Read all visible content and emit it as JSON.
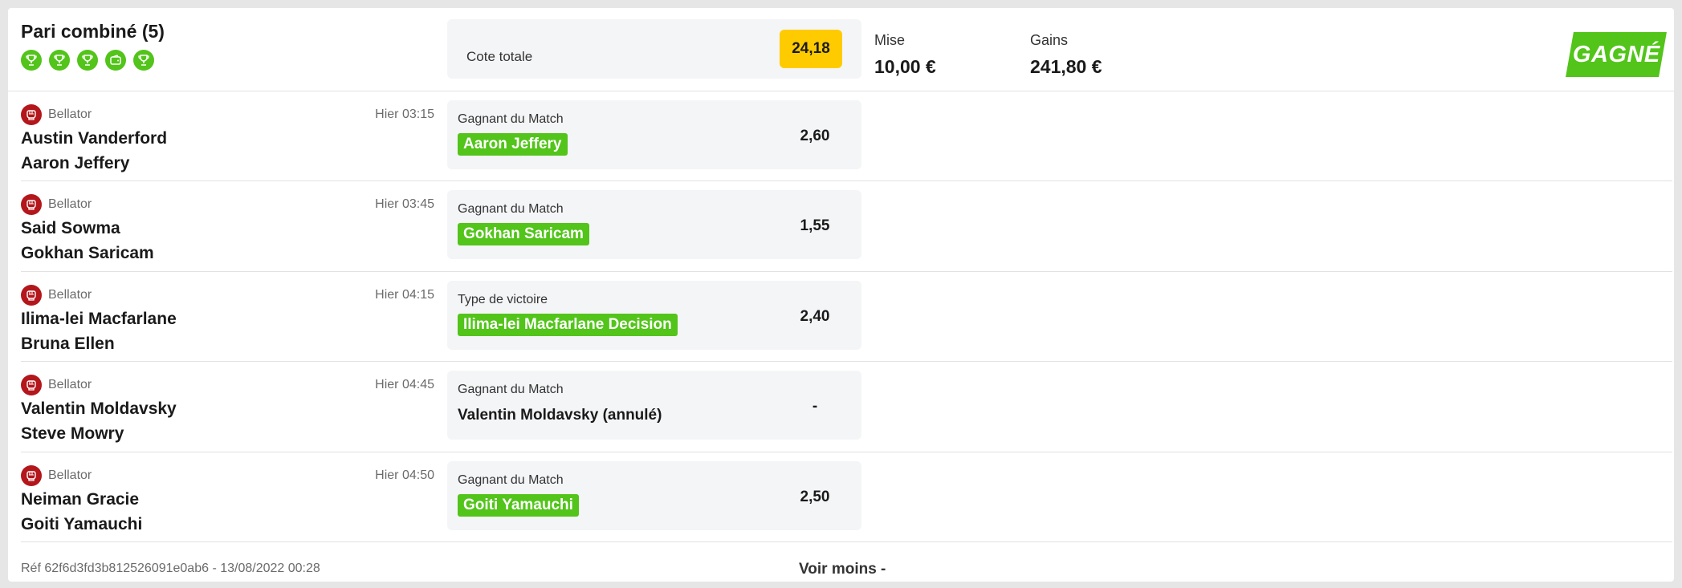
{
  "header": {
    "title": "Pari combiné (5)",
    "result_icons": [
      "trophy-icon",
      "trophy-icon",
      "trophy-icon",
      "refund-icon",
      "trophy-icon"
    ],
    "cote_label": "Cote totale",
    "cote_value": "24,18",
    "mise_label": "Mise",
    "mise_value": "10,00 €",
    "gains_label": "Gains",
    "gains_value": "241,80 €",
    "status": "GAGNÉ"
  },
  "colors": {
    "win_green": "#52c41a",
    "cote_yellow": "#fecb00",
    "league_red": "#b3161b",
    "panel_bg": "#f4f5f7"
  },
  "selections": [
    {
      "league": "Bellator",
      "league_icon": "mma-glove-icon",
      "time": "Hier 03:15",
      "player1": "Austin Vanderford",
      "player2": "Aaron Jeffery",
      "market": "Gagnant du Match",
      "pick": "Aaron Jeffery",
      "pick_won": true,
      "odds": "2,60"
    },
    {
      "league": "Bellator",
      "league_icon": "mma-glove-icon",
      "time": "Hier 03:45",
      "player1": "Said Sowma",
      "player2": "Gokhan Saricam",
      "market": "Gagnant du Match",
      "pick": "Gokhan Saricam",
      "pick_won": true,
      "odds": "1,55"
    },
    {
      "league": "Bellator",
      "league_icon": "mma-glove-icon",
      "time": "Hier 04:15",
      "player1": "Ilima-lei Macfarlane",
      "player2": "Bruna Ellen",
      "market": "Type de victoire",
      "pick": "Ilima-lei Macfarlane Decision",
      "pick_won": true,
      "odds": "2,40"
    },
    {
      "league": "Bellator",
      "league_icon": "mma-glove-icon",
      "time": "Hier 04:45",
      "player1": "Valentin Moldavsky",
      "player2": "Steve Mowry",
      "market": "Gagnant du Match",
      "pick": "Valentin Moldavsky (annulé)",
      "pick_won": false,
      "odds": "-"
    },
    {
      "league": "Bellator",
      "league_icon": "mma-glove-icon",
      "time": "Hier 04:50",
      "player1": "Neiman Gracie",
      "player2": "Goiti Yamauchi",
      "market": "Gagnant du Match",
      "pick": "Goiti Yamauchi",
      "pick_won": true,
      "odds": "2,50"
    }
  ],
  "footer": {
    "reference": "Réf 62f6d3fd3b812526091e0ab6 - 13/08/2022 00:28",
    "toggle_label": "Voir moins -"
  }
}
